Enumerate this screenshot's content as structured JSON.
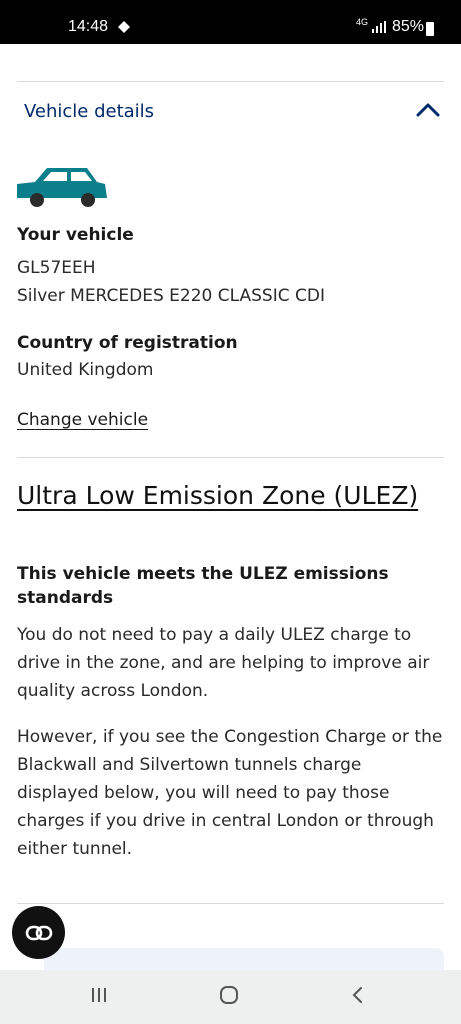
{
  "status_bar": {
    "time": "14:48",
    "network": "4G",
    "battery": "85%"
  },
  "vehicle_section": {
    "title": "Vehicle details",
    "your_vehicle_label": "Your vehicle",
    "registration": "GL57EEH",
    "description": "Silver MERCEDES E220 CLASSIC CDI",
    "country_label": "Country of registration",
    "country": "United Kingdom",
    "change_link": "Change vehicle"
  },
  "ulez": {
    "title": "Ultra Low Emission Zone (ULEZ)",
    "status": "This vehicle meets the ULEZ emissions standards",
    "paragraph1": "You do not need to pay a daily ULEZ charge to drive in the zone, and are helping to improve air quality across London.",
    "paragraph2": "However, if you see the Congestion Charge or the Blackwall and Silvertown tunnels charge displayed below, you will need to pay those charges if you drive in central London or through either tunnel."
  },
  "colors": {
    "accent_blue": "#002b6b",
    "car_teal": "#0b7f8c"
  },
  "icons": {
    "chevron": "chevron-up-icon",
    "car": "car-icon",
    "fab": "link-icon"
  }
}
